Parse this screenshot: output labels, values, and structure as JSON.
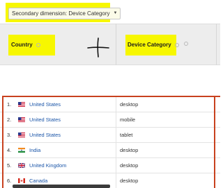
{
  "toolbar": {
    "secondary_dimension_label": "Secondary dimension: Device Category"
  },
  "table": {
    "headers": {
      "country": "Country",
      "device_category": "Device Category"
    },
    "rows": [
      {
        "num": "1.",
        "country": "United States",
        "flag": "us-flag-icon",
        "device": "desktop"
      },
      {
        "num": "2.",
        "country": "United States",
        "flag": "us-flag-icon",
        "device": "mobile"
      },
      {
        "num": "3.",
        "country": "United States",
        "flag": "us-flag-icon",
        "device": "tablet"
      },
      {
        "num": "4.",
        "country": "India",
        "flag": "india-flag-icon",
        "device": "desktop"
      },
      {
        "num": "5.",
        "country": "United Kingdom",
        "flag": "uk-flag-icon",
        "device": "desktop"
      },
      {
        "num": "6.",
        "country": "Canada",
        "flag": "canada-flag-icon",
        "device": "desktop"
      }
    ]
  },
  "colors": {
    "highlight": "#f7f700",
    "annotation_red": "#c8411e",
    "link_blue": "#1a55a8",
    "header_bg": "#ededed"
  }
}
